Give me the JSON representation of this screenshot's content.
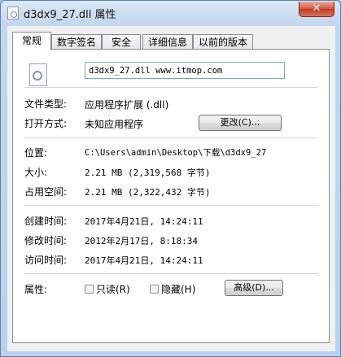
{
  "window": {
    "title": "d3dx9_27.dll 属性",
    "close_glyph": "✕"
  },
  "tabs": [
    {
      "label": "常规"
    },
    {
      "label": "数字签名"
    },
    {
      "label": "安全"
    },
    {
      "label": "详细信息"
    },
    {
      "label": "以前的版本"
    }
  ],
  "general": {
    "filename_value": "d3dx9_27.dll www.itmop.com",
    "file_type": {
      "label": "文件类型:",
      "value": "应用程序扩展 (.dll)"
    },
    "open_with": {
      "label": "打开方式:",
      "value": "未知应用程序",
      "button": "更改(C)..."
    },
    "location": {
      "label": "位置:",
      "value": "C:\\Users\\admin\\Desktop\\下载\\d3dx9_27"
    },
    "size": {
      "label": "大小:",
      "value": "2.21 MB (2,319,568 字节)"
    },
    "size_on_disk": {
      "label": "占用空间:",
      "value": "2.21 MB (2,322,432 字节)"
    },
    "created": {
      "label": "创建时间:",
      "value": "2017年4月21日, 14:24:11"
    },
    "modified": {
      "label": "修改时间:",
      "value": "2012年2月17日, 8:18:34"
    },
    "accessed": {
      "label": "访问时间:",
      "value": "2017年4月21日, 14:24:11"
    },
    "attributes": {
      "label": "属性:",
      "readonly": "只读(R)",
      "hidden": "隐藏(H)",
      "advanced_button": "高级(D)..."
    }
  }
}
